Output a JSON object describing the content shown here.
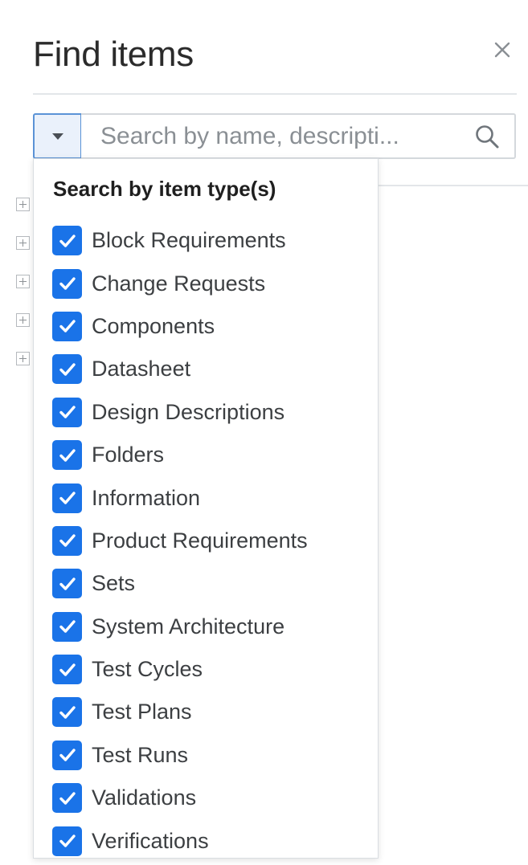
{
  "dialog": {
    "title": "Find items"
  },
  "search": {
    "placeholder": "Search by name, descripti..."
  },
  "dropdown": {
    "heading": "Search by item type(s)",
    "options": [
      {
        "label": "Block Requirements",
        "checked": true
      },
      {
        "label": "Change Requests",
        "checked": true
      },
      {
        "label": "Components",
        "checked": true
      },
      {
        "label": "Datasheet",
        "checked": true
      },
      {
        "label": "Design Descriptions",
        "checked": true
      },
      {
        "label": "Folders",
        "checked": true
      },
      {
        "label": "Information",
        "checked": true
      },
      {
        "label": "Product Requirements",
        "checked": true
      },
      {
        "label": "Sets",
        "checked": true
      },
      {
        "label": "System Architecture",
        "checked": true
      },
      {
        "label": "Test Cycles",
        "checked": true
      },
      {
        "label": "Test Plans",
        "checked": true
      },
      {
        "label": "Test Runs",
        "checked": true
      },
      {
        "label": "Validations",
        "checked": true
      },
      {
        "label": "Verifications",
        "checked": true
      }
    ]
  },
  "tree": {
    "expander_count": 5
  },
  "colors": {
    "checkbox": "#1a73e8",
    "toggle_border": "#5b93d6",
    "toggle_bg": "#eaf1fb"
  }
}
